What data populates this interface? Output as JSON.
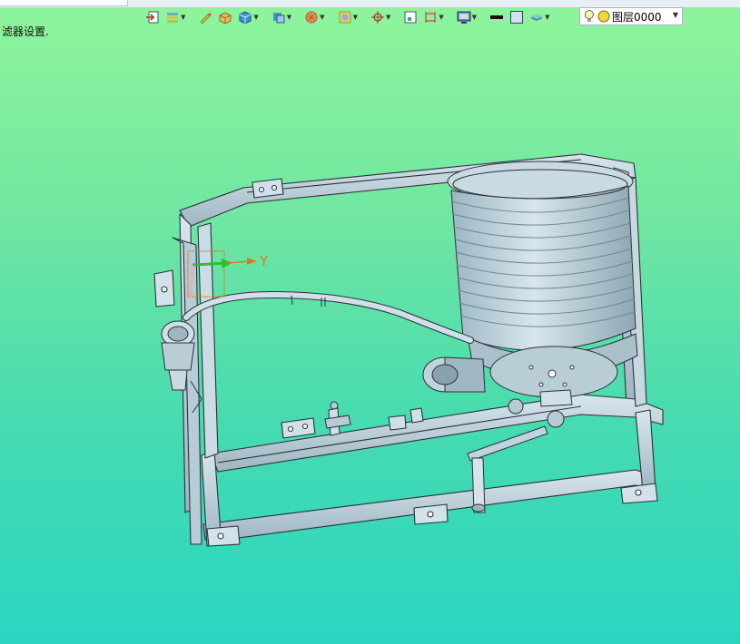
{
  "status_text": "滤器设置.",
  "toolbar": {
    "buttons": [
      {
        "icon": "import-icon",
        "dropdown": false
      },
      {
        "icon": "layer-manager-icon",
        "dropdown": true
      },
      {
        "icon": "pencil-icon",
        "dropdown": false
      },
      {
        "icon": "box-yellow-icon",
        "dropdown": false
      },
      {
        "icon": "cube-blue-icon",
        "dropdown": true
      },
      {
        "icon": "shaded-view-icon",
        "dropdown": true
      },
      {
        "icon": "render-sphere-icon",
        "dropdown": true
      },
      {
        "icon": "view-frame-icon",
        "dropdown": true
      },
      {
        "icon": "snap-point-icon",
        "dropdown": true
      },
      {
        "icon": "fit-window-icon",
        "dropdown": false
      },
      {
        "icon": "dimension-icon",
        "dropdown": true
      },
      {
        "icon": "display-mode-icon",
        "dropdown": true
      },
      {
        "icon": "line-weight-icon",
        "dropdown": false
      },
      {
        "icon": "color-swatch-icon",
        "dropdown": false
      },
      {
        "icon": "layer-stack-icon",
        "dropdown": true
      }
    ]
  },
  "layer_select": {
    "value": "图层0000"
  },
  "axis": {
    "label": "Y"
  },
  "colors": {
    "bg_top": "#8ff59b",
    "bg_bottom": "#2ad6c2",
    "part": "#b8cfd9",
    "edge": "#2a3238",
    "axis": "#e07a1f",
    "triad_green": "#2fbf2f"
  }
}
